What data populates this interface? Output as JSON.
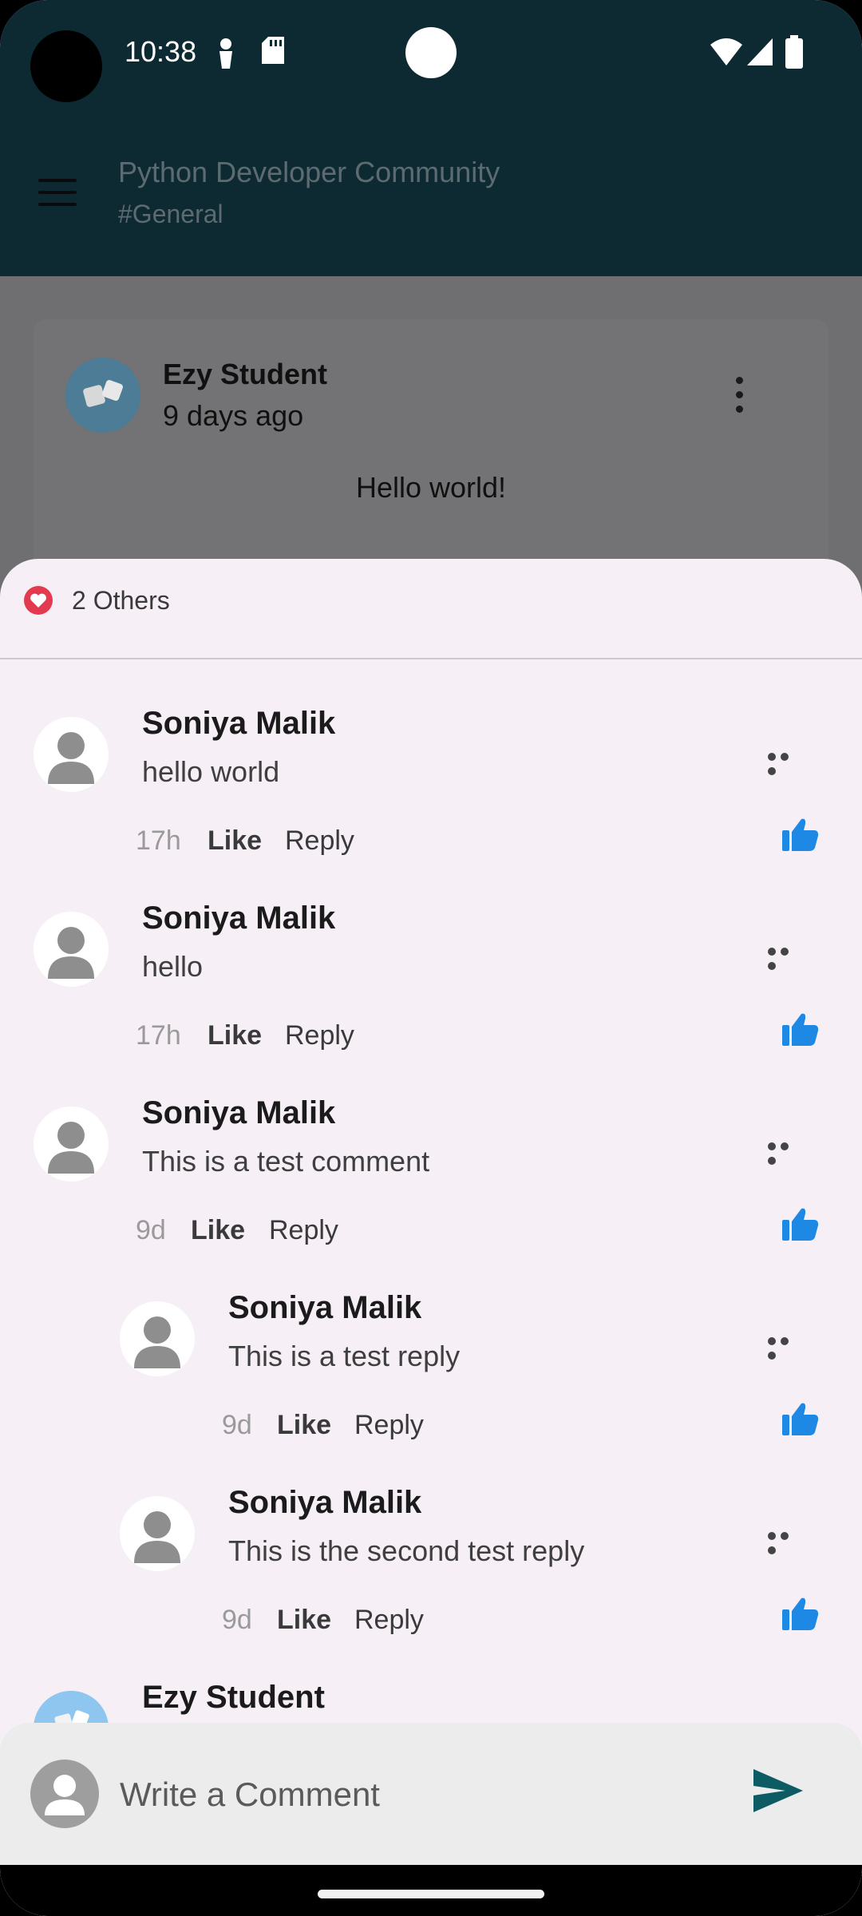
{
  "status_bar": {
    "time": "10:38"
  },
  "app_bar": {
    "title": "Python Developer Community",
    "subtitle": "#General"
  },
  "post": {
    "author": "Ezy Student",
    "time": "9 days ago",
    "text": "Hello world!"
  },
  "sheet": {
    "reactions_text": "2 Others",
    "comments": [
      {
        "name": "Soniya Malik",
        "text": "hello world",
        "time": "17h",
        "like": "Like",
        "reply": "Reply"
      },
      {
        "name": "Soniya Malik",
        "text": "hello",
        "time": "17h",
        "like": "Like",
        "reply": "Reply"
      },
      {
        "name": "Soniya Malik",
        "text": "This is a test comment",
        "time": "9d",
        "like": "Like",
        "reply": "Reply"
      },
      {
        "name": "Soniya Malik",
        "text": "This is a test reply",
        "time": "9d",
        "like": "Like",
        "reply": "Reply"
      },
      {
        "name": "Soniya Malik",
        "text": "This is the second test reply",
        "time": "9d",
        "like": "Like",
        "reply": "Reply"
      },
      {
        "name": "Ezy Student"
      }
    ]
  },
  "composer": {
    "placeholder": "Write a Comment"
  },
  "colors": {
    "app_bar": "#0d2a33",
    "like_blue": "#1e88e5",
    "send": "#0d5c63",
    "heart": "#e23a4e"
  }
}
